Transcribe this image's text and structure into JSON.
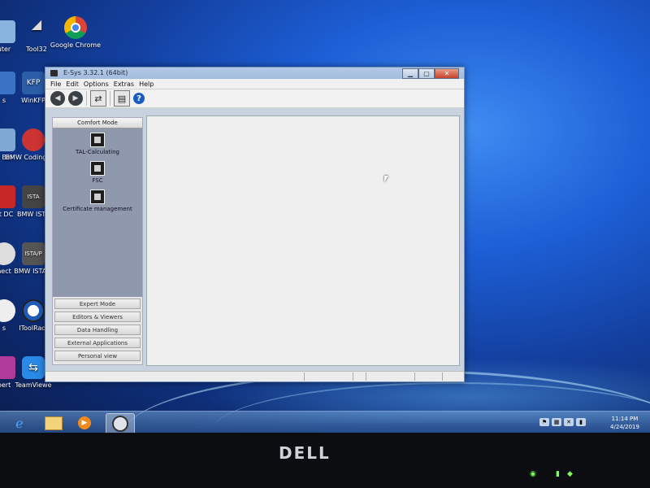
{
  "desktop_icons": [
    {
      "label": "uter",
      "icon": "computer-icon"
    },
    {
      "label": "Tool32",
      "icon": "tool32-icon"
    },
    {
      "label": "Google Chrome",
      "icon": "chrome-icon"
    },
    {
      "label": "s",
      "icon": "shortcut-icon"
    },
    {
      "label": "WinKFP",
      "icon": "winkfp-icon"
    },
    {
      "label": "e Bin",
      "icon": "recycle-bin-icon"
    },
    {
      "label": "BMW Coding Tool",
      "icon": "bmw-coding-tool-icon"
    },
    {
      "label": "at DC",
      "icon": "shortcut-icon"
    },
    {
      "label": "BMW ISTA",
      "icon": "ista-icon"
    },
    {
      "label": "nect",
      "icon": "connect-icon"
    },
    {
      "label": "BMW ISTA-P",
      "icon": "ista-p-icon"
    },
    {
      "label": "s",
      "icon": "shortcut-icon"
    },
    {
      "label": "IToolRadi",
      "icon": "itoolradar-icon"
    },
    {
      "label": "pert",
      "icon": "shortcut-icon"
    },
    {
      "label": "TeamViewe",
      "icon": "teamviewer-icon"
    }
  ],
  "window": {
    "title": "E-Sys 3.32.1 (64bit)",
    "buttons": {
      "minimize": "▁",
      "maximize": "▢",
      "close": "✕"
    }
  },
  "menu": [
    "File",
    "Edit",
    "Options",
    "Extras",
    "Help"
  ],
  "toolbar": [
    "back-icon",
    "forward-icon",
    "connect-icon",
    "file-icon",
    "help-icon"
  ],
  "left_panel": {
    "header": "Comfort Mode",
    "functions": [
      "TAL-Calculating",
      "FSC",
      "Certificate management"
    ],
    "modes": [
      "Expert Mode",
      "Editors & Viewers",
      "Data Handling",
      "External Applications",
      "Personal view"
    ]
  },
  "taskbar": {
    "items": [
      "internet-explorer-icon",
      "explorer-icon",
      "media-player-icon",
      "esys-icon"
    ],
    "tray_icons": [
      "flag-icon",
      "network-icon",
      "volume-mute-icon",
      "power-icon"
    ],
    "time": "11:14 PM",
    "date": "4/24/2019"
  },
  "bezel": {
    "brand": "DELL"
  }
}
